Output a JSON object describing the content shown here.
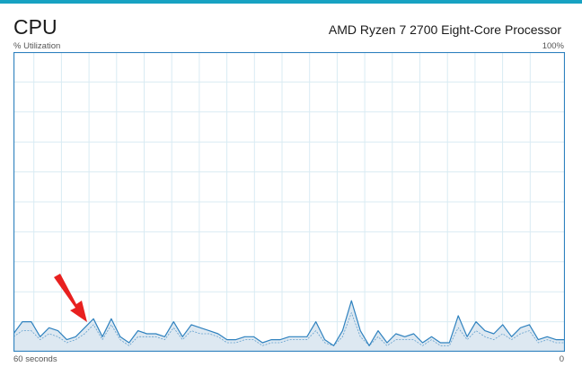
{
  "header": {
    "title": "CPU",
    "processor_name": "AMD Ryzen 7 2700 Eight-Core Processor",
    "accent_color": "#17a2c2"
  },
  "graph": {
    "y_axis_label": "% Utilization",
    "y_max_label": "100%",
    "x_time_label": "60 seconds",
    "x_end_label": "0",
    "line_color": "#2f82bf",
    "fill_color": "#dde8f1",
    "grid_color": "#d9ebf3",
    "border_color": "#2f82bf"
  },
  "chart_data": {
    "type": "area",
    "title": "",
    "xlabel": "",
    "ylabel": "% Utilization",
    "xlim": [
      60,
      0
    ],
    "ylim": [
      0,
      100
    ],
    "grid": true,
    "series": [
      {
        "values": [
          6,
          10,
          10,
          5,
          8,
          7,
          4,
          5,
          8,
          11,
          5,
          11,
          5,
          3,
          7,
          6,
          6,
          5,
          10,
          5,
          9,
          8,
          7,
          6,
          4,
          4,
          5,
          5,
          3,
          4,
          4,
          5,
          5,
          5,
          10,
          4,
          2,
          7,
          17,
          7,
          2,
          7,
          3,
          6,
          5,
          6,
          3,
          5,
          3,
          3,
          12,
          5,
          10,
          7,
          6,
          9,
          5,
          8,
          9,
          4,
          5,
          4,
          4
        ]
      },
      {
        "values": [
          5,
          7,
          7,
          4,
          6,
          5,
          3,
          4,
          6,
          9,
          4,
          9,
          4,
          2,
          5,
          5,
          5,
          4,
          8,
          4,
          7,
          6,
          6,
          5,
          3,
          3,
          4,
          4,
          2,
          3,
          3,
          4,
          4,
          4,
          7,
          3,
          2,
          5,
          13,
          5,
          2,
          5,
          2,
          4,
          4,
          4,
          2,
          4,
          2,
          2,
          8,
          4,
          7,
          5,
          4,
          6,
          4,
          6,
          7,
          3,
          4,
          3,
          3
        ]
      }
    ]
  },
  "annotation": {
    "arrow_color": "#e8201f"
  }
}
